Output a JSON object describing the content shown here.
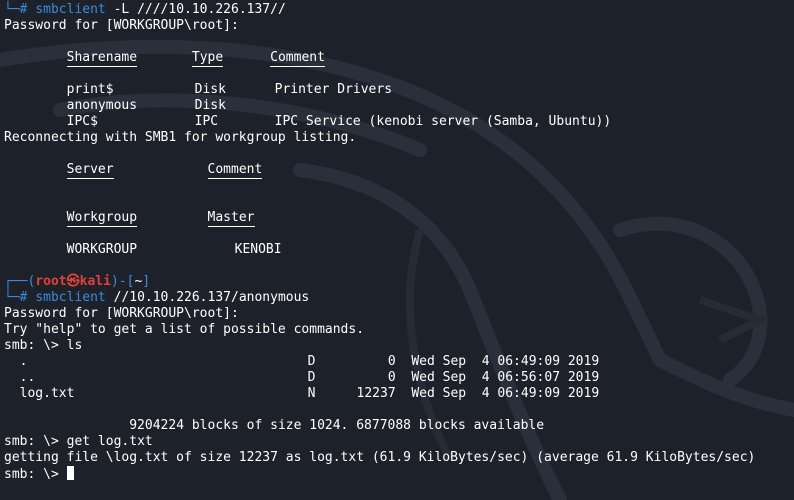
{
  "colors": {
    "background": "#1d2129",
    "prompt_blue": "#3e8bd9",
    "prompt_red": "#e2413b",
    "text": "#ffffff"
  },
  "icons": {
    "skull": "kali-skull-icon",
    "dragon": "kali-dragon-background"
  },
  "prompt": {
    "corner_top": "┌──(",
    "user": "root",
    "host": "kali",
    "sep": ")-[",
    "dir": "~",
    "close": "]",
    "corner_bottom": "└─",
    "hash": "#"
  },
  "cmd1": {
    "program": "smbclient",
    "args": " -L ////10.10.226.137//"
  },
  "password_prompt": "Password for [WORKGROUP\\root]:",
  "shares_header": {
    "name": "Sharename",
    "type": "Type",
    "comment": "Comment"
  },
  "shares": [
    {
      "name": "print$",
      "type": "Disk",
      "comment": "Printer Drivers"
    },
    {
      "name": "anonymous",
      "type": "Disk",
      "comment": ""
    },
    {
      "name": "IPC$",
      "type": "IPC",
      "comment": "IPC Service (kenobi server (Samba, Ubuntu))"
    }
  ],
  "reconnect_msg": "Reconnecting with SMB1 for workgroup listing.",
  "server_header": {
    "server": "Server",
    "comment": "Comment"
  },
  "workgroup_header": {
    "workgroup": "Workgroup",
    "master": "Master"
  },
  "workgroups": [
    {
      "workgroup": "WORKGROUP",
      "master": "KENOBI"
    }
  ],
  "cmd2": {
    "program": "smbclient",
    "args": " //10.10.226.137/anonymous"
  },
  "help_msg": "Try \"help\" to get a list of possible commands.",
  "smb_prompt": "smb: \\> ",
  "smb_cmd1": "ls",
  "files": [
    {
      "name": ".",
      "attr": "D",
      "size": "0",
      "date": "Wed Sep  4 06:49:09 2019"
    },
    {
      "name": "..",
      "attr": "D",
      "size": "0",
      "date": "Wed Sep  4 06:56:07 2019"
    },
    {
      "name": "log.txt",
      "attr": "N",
      "size": "12237",
      "date": "Wed Sep  4 06:49:09 2019"
    }
  ],
  "blocks_msg": "9204224 blocks of size 1024. 6877088 blocks available",
  "smb_cmd2": "get log.txt",
  "getting_msg": "getting file \\log.txt of size 12237 as log.txt (61.9 KiloBytes/sec) (average 61.9 KiloBytes/sec)"
}
